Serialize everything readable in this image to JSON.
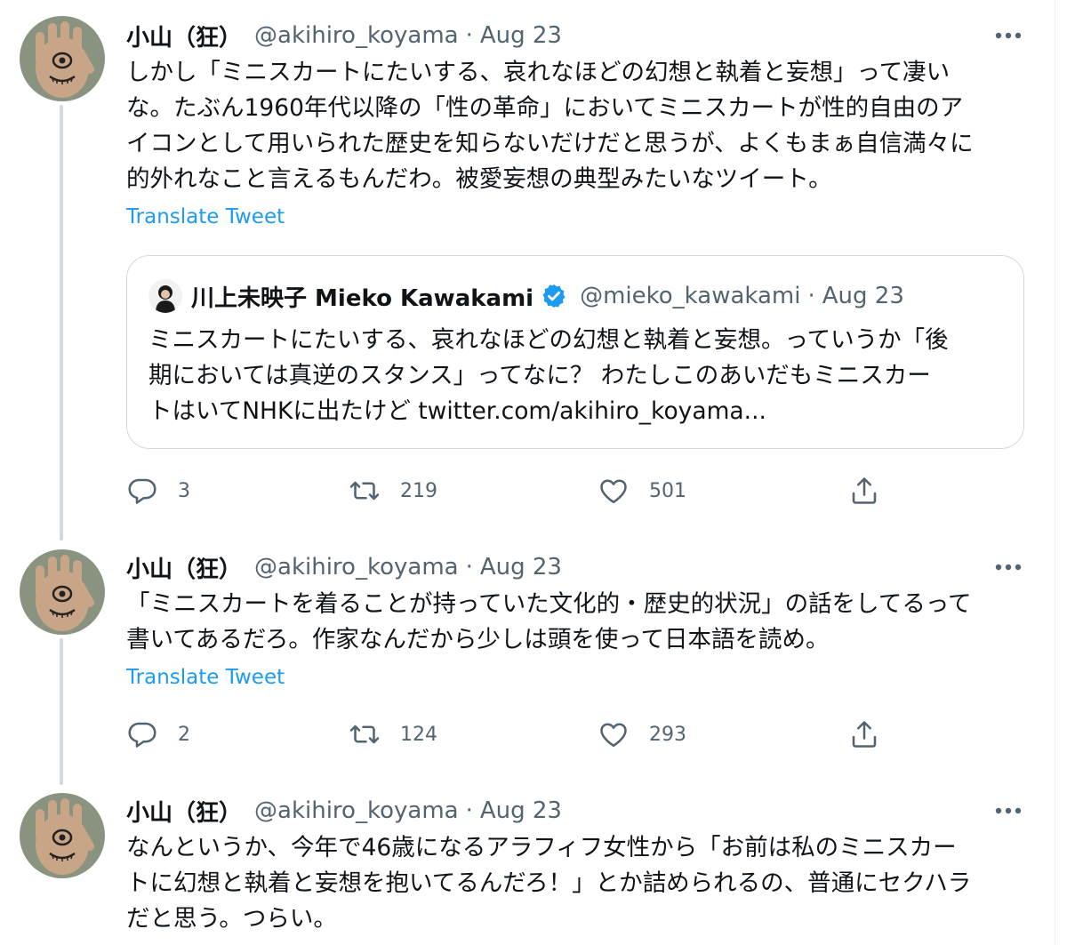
{
  "tweets": [
    {
      "name": "小山（狂）",
      "handle": "@akihiro_koyama",
      "separator": "·",
      "date": "Aug 23",
      "lines": [
        "しかし「ミニスカートにたいする、哀れなほどの幻想と執着と妄想」って凄い",
        "な。たぶん1960年代以降の「性の革命」においてミニスカートが性的自由のア",
        "イコンとして用いられた歴史を知らないだけだと思うが、よくもまぁ自信満々に",
        "的外れなこと言えるもんだわ。被愛妄想の典型みたいなツイート。"
      ],
      "translate": "Translate Tweet",
      "quote": {
        "name": "川上未映子 Mieko Kawakami",
        "handle": "@mieko_kawakami",
        "separator": "·",
        "date": "Aug 23",
        "lines": [
          "ミニスカートにたいする、哀れなほどの幻想と執着と妄想。っていうか「後",
          "期においては真逆のスタンス」ってなに？ わたしこのあいだもミニスカー",
          "トはいてNHKに出たけど twitter.com/akihiro_koyama..."
        ]
      },
      "replies": "3",
      "retweets": "219",
      "likes": "501"
    },
    {
      "name": "小山（狂）",
      "handle": "@akihiro_koyama",
      "separator": "·",
      "date": "Aug 23",
      "lines": [
        "「ミニスカートを着ることが持っていた文化的・歴史的状況」の話をしてるって",
        "書いてあるだろ。作家なんだから少しは頭を使って日本語を読め。"
      ],
      "translate": "Translate Tweet",
      "replies": "2",
      "retweets": "124",
      "likes": "293"
    },
    {
      "name": "小山（狂）",
      "handle": "@akihiro_koyama",
      "separator": "·",
      "date": "Aug 23",
      "lines": [
        "なんというか、今年で46歳になるアラフィフ女性から「お前は私のミニスカー",
        "トに幻想と執着と妄想を抱いてるんだろ！」とか詰められるの、普通にセクハラ",
        "だと思う。つらい。"
      ]
    }
  ],
  "icons": {
    "more": "more-horizontal-icon",
    "reply": "reply-bubble-icon",
    "retweet": "retweet-arrows-icon",
    "like": "heart-outline-icon",
    "share": "share-upload-icon",
    "verified": "verified-badge-icon"
  },
  "colors": {
    "link": "#1d9bf0",
    "secondary_text": "#536471",
    "thread_line": "#cfd9de",
    "verified": "#1d9bf0"
  }
}
